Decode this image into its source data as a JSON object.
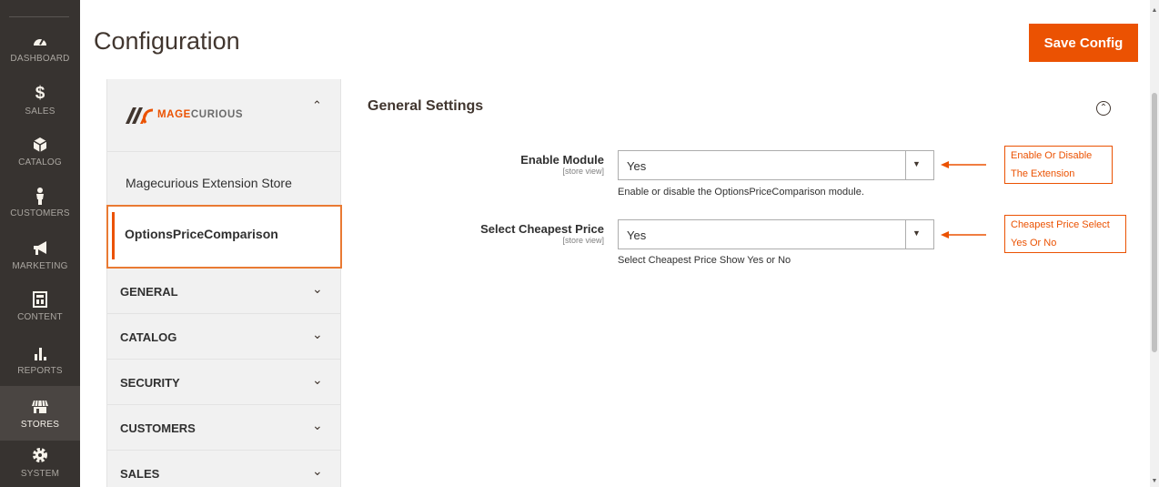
{
  "nav": {
    "items": [
      {
        "label": "DASHBOARD",
        "icon": "dashboard-icon"
      },
      {
        "label": "SALES",
        "icon": "dollar-icon"
      },
      {
        "label": "CATALOG",
        "icon": "box-icon"
      },
      {
        "label": "CUSTOMERS",
        "icon": "person-icon"
      },
      {
        "label": "MARKETING",
        "icon": "megaphone-icon"
      },
      {
        "label": "CONTENT",
        "icon": "layout-icon"
      },
      {
        "label": "REPORTS",
        "icon": "bar-chart-icon"
      },
      {
        "label": "STORES",
        "icon": "storefront-icon"
      },
      {
        "label": "SYSTEM",
        "icon": "gear-icon"
      }
    ],
    "active": "STORES"
  },
  "header": {
    "title": "Configuration",
    "save_label": "Save Config"
  },
  "tabs": {
    "brand_prefix": "MAGE",
    "brand_suffix": "CURIOUS",
    "store_link": "Magecurious Extension Store",
    "active_link": "OptionsPriceComparison",
    "sections": [
      "GENERAL",
      "CATALOG",
      "SECURITY",
      "CUSTOMERS",
      "SALES"
    ]
  },
  "settings": {
    "title": "General Settings",
    "fields": [
      {
        "label": "Enable Module",
        "scope": "[store view]",
        "value": "Yes",
        "note": "Enable or disable the OptionsPriceComparison module.",
        "callout": [
          "Enable Or Disable",
          "The Extension"
        ]
      },
      {
        "label": "Select Cheapest Price",
        "scope": "[store view]",
        "value": "Yes",
        "note": "Select Cheapest Price Show Yes or No",
        "callout": [
          "Cheapest Price Select",
          "Yes Or No"
        ]
      }
    ]
  },
  "colors": {
    "accent": "#eb5202",
    "nav_bg": "#373330",
    "panel_bg": "#f1f1f1"
  }
}
